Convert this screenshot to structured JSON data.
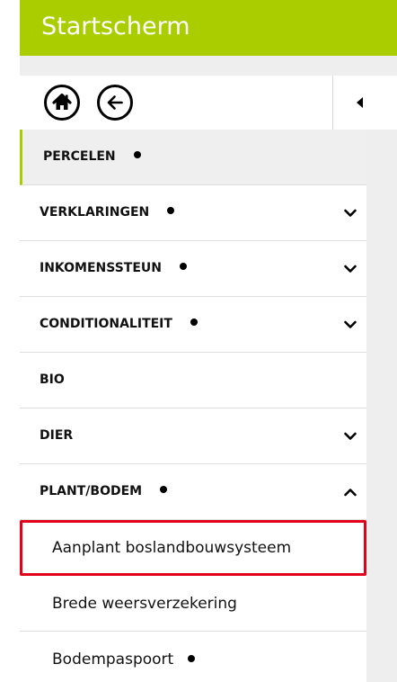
{
  "header": {
    "title": "Startscherm",
    "color": "#aacd00"
  },
  "toolbar": {
    "home_icon": "home-icon",
    "back_icon": "arrow-left-icon",
    "collapse_icon": "caret-left-icon"
  },
  "menu": {
    "items": [
      {
        "label": "PERCELEN",
        "dot": true,
        "active": true,
        "chevron": "none"
      },
      {
        "label": "VERKLARINGEN",
        "dot": true,
        "chevron": "down"
      },
      {
        "label": "INKOMENSSTEUN",
        "dot": true,
        "chevron": "down"
      },
      {
        "label": "CONDITIONALITEIT",
        "dot": true,
        "chevron": "down"
      },
      {
        "label": "BIO",
        "dot": false,
        "chevron": "none"
      },
      {
        "label": "DIER",
        "dot": false,
        "chevron": "down"
      },
      {
        "label": "PLANT/BODEM",
        "dot": true,
        "chevron": "up"
      }
    ],
    "submenu": [
      {
        "label": "Aanplant boslandbouwsysteem",
        "highlighted": true,
        "dot": false
      },
      {
        "label": "Brede weersverzekering",
        "dot": false
      },
      {
        "label": "Bodempaspoort",
        "dot": true
      }
    ]
  },
  "colors": {
    "accent": "#aacd00",
    "highlight_border": "#e2001a",
    "active_background": "#efefef"
  }
}
